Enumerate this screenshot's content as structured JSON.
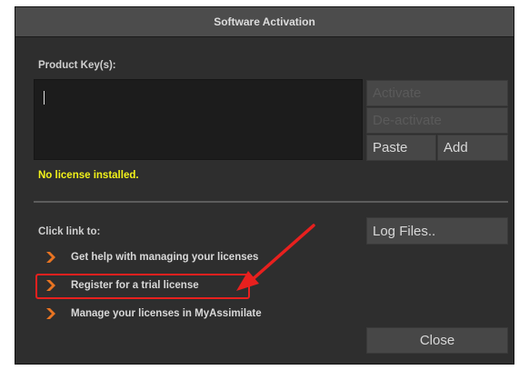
{
  "window": {
    "title": "Software Activation"
  },
  "product_key": {
    "label": "Product Key(s):",
    "value": ""
  },
  "buttons": {
    "activate": "Activate",
    "deactivate": "De-activate",
    "paste": "Paste",
    "add": "Add",
    "log_files": "Log Files..",
    "close": "Close"
  },
  "status": {
    "text": "No license installed.",
    "color": "#f2f21a"
  },
  "links": {
    "label": "Click link to:",
    "items": [
      {
        "text": "Get help with managing your licenses",
        "icon": "chevron-right-icon"
      },
      {
        "text": "Register for a trial license",
        "icon": "chevron-right-icon"
      },
      {
        "text": "Manage your licenses in MyAssimilate",
        "icon": "chevron-right-icon"
      }
    ]
  },
  "colors": {
    "accent_chevron": "#e87422",
    "annotation": "#e8201e"
  }
}
